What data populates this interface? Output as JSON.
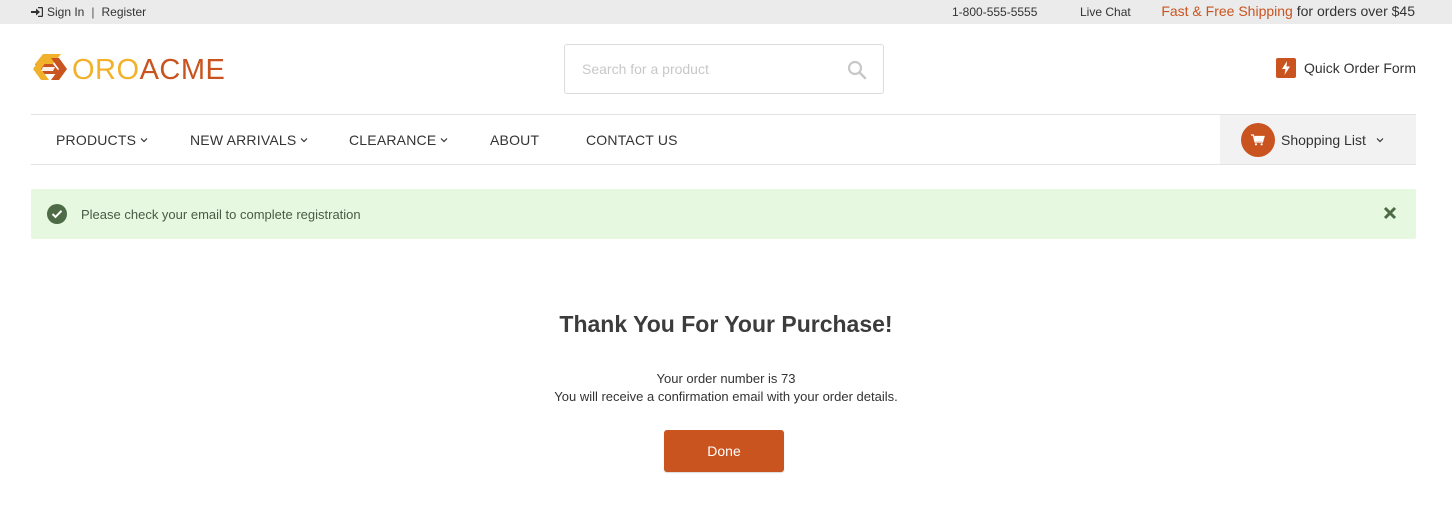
{
  "topbar": {
    "sign_in": "Sign In",
    "separator": "|",
    "register": "Register",
    "phone": "1-800-555-5555",
    "live_chat": "Live Chat",
    "shipping_highlight": "Fast & Free Shipping",
    "shipping_rest": " for orders over $45"
  },
  "header": {
    "logo_oro": "ORO",
    "logo_acme": "ACME",
    "search_placeholder": "Search for a product",
    "search_value": "",
    "quick_order_label": "Quick Order Form"
  },
  "nav": {
    "items": [
      {
        "label": "PRODUCTS",
        "has_dropdown": true
      },
      {
        "label": "NEW ARRIVALS",
        "has_dropdown": true
      },
      {
        "label": "CLEARANCE",
        "has_dropdown": true
      },
      {
        "label": "ABOUT",
        "has_dropdown": false
      },
      {
        "label": "CONTACT US",
        "has_dropdown": false
      }
    ],
    "shopping_list_label": "Shopping List"
  },
  "alert": {
    "message": "Please check your email to complete registration",
    "type": "success",
    "icons": [
      "check-circle-icon",
      "close-icon"
    ]
  },
  "main": {
    "title": "Thank You For Your Purchase!",
    "order_line": "Your order number is 73",
    "confirmation_line": "You will receive a confirmation email with your order details.",
    "done_label": "Done"
  },
  "colors": {
    "brand_orange": "#c9541f",
    "brand_yellow": "#f1b12a",
    "alert_bg": "#e6f8df",
    "topbar_bg": "#ebebeb"
  }
}
